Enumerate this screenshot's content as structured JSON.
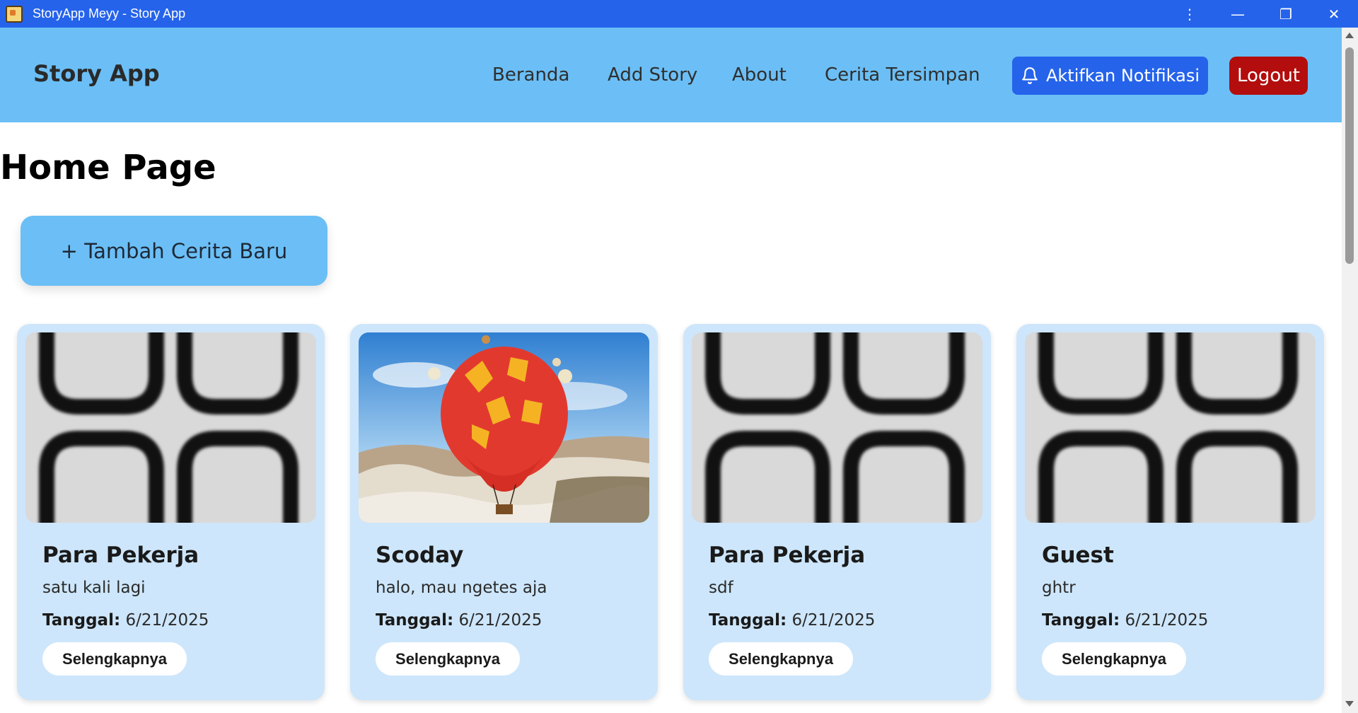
{
  "window": {
    "title": "StoryApp Meyy - Story App",
    "controls": {
      "menu": "⋮",
      "minimize": "—",
      "restore": "❐",
      "close": "✕"
    }
  },
  "navbar": {
    "brand": "Story App",
    "links": [
      "Beranda",
      "Add Story",
      "About",
      "Cerita Tersimpan"
    ],
    "notify_label": "Aktifkan Notifikasi",
    "logout_label": "Logout"
  },
  "main": {
    "title": "Home Page",
    "add_button": "+ Tambah Cerita Baru",
    "date_label": "Tanggal:",
    "more_label": "Selengkapnya",
    "stories": [
      {
        "name": "Para Pekerja",
        "description": "satu kali lagi",
        "date": "6/21/2025",
        "image": "placeholder-pattern"
      },
      {
        "name": "Scoday",
        "description": "halo, mau ngetes aja",
        "date": "6/21/2025",
        "image": "hot-air-balloon-photo"
      },
      {
        "name": "Para Pekerja",
        "description": "sdf",
        "date": "6/21/2025",
        "image": "placeholder-pattern"
      },
      {
        "name": "Guest",
        "description": "ghtr",
        "date": "6/21/2025",
        "image": "placeholder-pattern"
      }
    ]
  },
  "colors": {
    "titlebar": "#2563eb",
    "navbar": "#6bbff6",
    "card": "#cde6fb",
    "notify_button": "#2563eb",
    "logout_button": "#b30d0d"
  }
}
